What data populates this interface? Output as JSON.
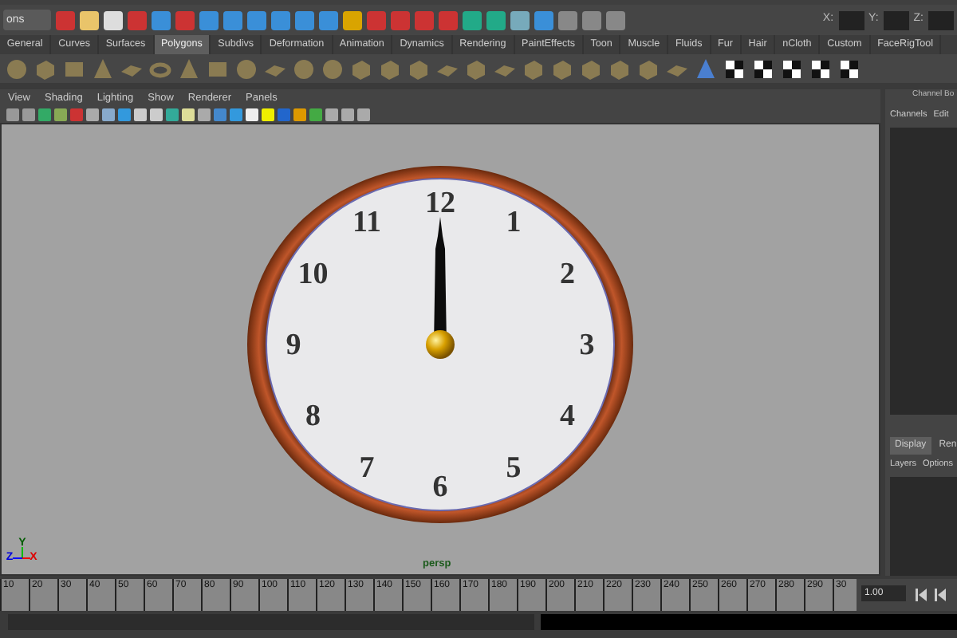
{
  "toolbar": {
    "mode_menu": "ons",
    "coord_labels": [
      "X:",
      "Y:",
      "Z:"
    ]
  },
  "shelf_tabs": [
    {
      "label": "General",
      "selected": false
    },
    {
      "label": "Curves",
      "selected": false
    },
    {
      "label": "Surfaces",
      "selected": false
    },
    {
      "label": "Polygons",
      "selected": true
    },
    {
      "label": "Subdivs",
      "selected": false
    },
    {
      "label": "Deformation",
      "selected": false
    },
    {
      "label": "Animation",
      "selected": false
    },
    {
      "label": "Dynamics",
      "selected": false
    },
    {
      "label": "Rendering",
      "selected": false
    },
    {
      "label": "PaintEffects",
      "selected": false
    },
    {
      "label": "Toon",
      "selected": false
    },
    {
      "label": "Muscle",
      "selected": false
    },
    {
      "label": "Fluids",
      "selected": false
    },
    {
      "label": "Fur",
      "selected": false
    },
    {
      "label": "Hair",
      "selected": false
    },
    {
      "label": "nCloth",
      "selected": false
    },
    {
      "label": "Custom",
      "selected": false
    },
    {
      "label": "FaceRigTool",
      "selected": false
    }
  ],
  "viewport": {
    "menu": [
      "View",
      "Shading",
      "Lighting",
      "Show",
      "Renderer",
      "Panels"
    ],
    "camera_label": "persp",
    "axis_labels": [
      "Y",
      "Z",
      "X"
    ],
    "clock": {
      "numerals": [
        "12",
        "1",
        "2",
        "3",
        "4",
        "5",
        "6",
        "7",
        "8",
        "9",
        "10",
        "11"
      ]
    }
  },
  "channel_box": {
    "title": "Channel Bo",
    "menu": [
      "Channels",
      "Edit"
    ]
  },
  "layer_editor": {
    "tabs": [
      {
        "label": "Display",
        "selected": true
      },
      {
        "label": "Ren",
        "selected": false
      }
    ],
    "menu": [
      "Layers",
      "Options"
    ]
  },
  "timeline": {
    "ticks": [
      "10",
      "20",
      "30",
      "40",
      "50",
      "60",
      "70",
      "80",
      "90",
      "100",
      "110",
      "120",
      "130",
      "140",
      "150",
      "160",
      "170",
      "180",
      "190",
      "200",
      "210",
      "220",
      "230",
      "240",
      "250",
      "260",
      "270",
      "280",
      "290",
      "30"
    ],
    "current_frame": "1.00"
  }
}
